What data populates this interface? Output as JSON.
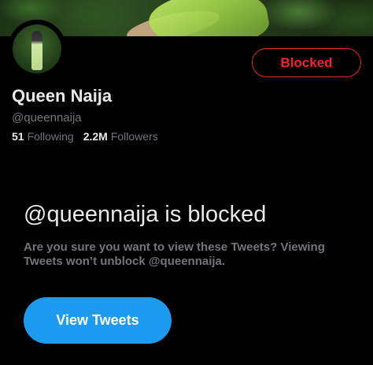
{
  "profile": {
    "display_name": "Queen Naija",
    "handle": "@queennaija",
    "following_count": "51",
    "following_label": "Following",
    "followers_count": "2.2M",
    "followers_label": "Followers"
  },
  "actions": {
    "blocked_label": "Blocked",
    "view_tweets_label": "View Tweets"
  },
  "blocked_notice": {
    "title": "@queennaija is blocked",
    "description": "Are you sure you want to view these Tweets? Viewing Tweets won’t unblock @queennaija."
  },
  "colors": {
    "background": "#000000",
    "text_primary": "#e7e9ea",
    "text_secondary": "#71767b",
    "blocked_red": "#f4212e",
    "accent_blue": "#1d9bf0"
  }
}
